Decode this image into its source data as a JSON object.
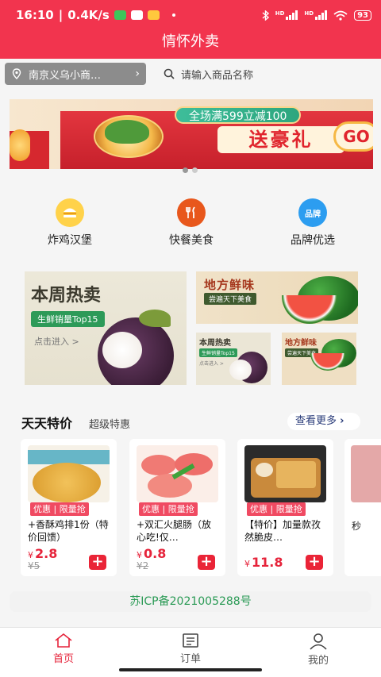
{
  "status_bar": {
    "time": "16:10",
    "speed": "0.4K/s",
    "battery": "93",
    "network_1": "HD",
    "network_2": "HD"
  },
  "header": {
    "title": "情怀外卖",
    "color": "#f2344e"
  },
  "location": {
    "text": "南京义乌小商…"
  },
  "search": {
    "placeholder": "请输入商品名称"
  },
  "banner": {
    "promo_text": "全场满599立减100",
    "headline": "送豪礼",
    "go_label": "GO"
  },
  "categories": [
    {
      "label": "炸鸡汉堡",
      "icon": "burger-icon"
    },
    {
      "label": "快餐美食",
      "icon": "fork-knife-icon"
    },
    {
      "label": "品牌优选",
      "icon": "brand-badge-icon",
      "icon_text": "品牌"
    }
  ],
  "promo_week": {
    "title": "本周热卖",
    "tag": "生鲜销量Top15",
    "link": "点击进入 >"
  },
  "promo_local": {
    "title": "地方鲜味",
    "tag": "尝遍天下美食"
  },
  "promo_mini_week": {
    "title": "本周热卖",
    "tag": "生鲜销量Top15",
    "link": "点击进入 >"
  },
  "promo_mini_local": {
    "title": "地方鲜味",
    "tag": "尝遍天下美食"
  },
  "specials": {
    "title": "天天特价",
    "subtitle": "超级特惠",
    "more_label": "查看更多",
    "items": [
      {
        "badge": "优惠 | 限量抢",
        "name": "+香酥鸡排1份（特价回馈）",
        "currency": "¥",
        "price": "2.8",
        "old_price": "¥5"
      },
      {
        "badge": "优惠 | 限量抢",
        "name": "+双汇火腿肠（放心吃!仅…",
        "currency": "¥",
        "price": "0.8",
        "old_price": "¥2"
      },
      {
        "badge": "优惠 | 限量抢",
        "name": "【特价】加量款孜然脆皮…",
        "currency": "¥",
        "price": "11.8",
        "old_price": ""
      }
    ],
    "partial_card_text": "秒"
  },
  "icp": "苏ICP备2021005288号",
  "nav": {
    "items": [
      {
        "label": "首页",
        "icon": "home-icon",
        "active": true
      },
      {
        "label": "订单",
        "icon": "orders-icon",
        "active": false
      },
      {
        "label": "我的",
        "icon": "profile-icon",
        "active": false
      }
    ]
  },
  "accent_color": "#e6243b"
}
